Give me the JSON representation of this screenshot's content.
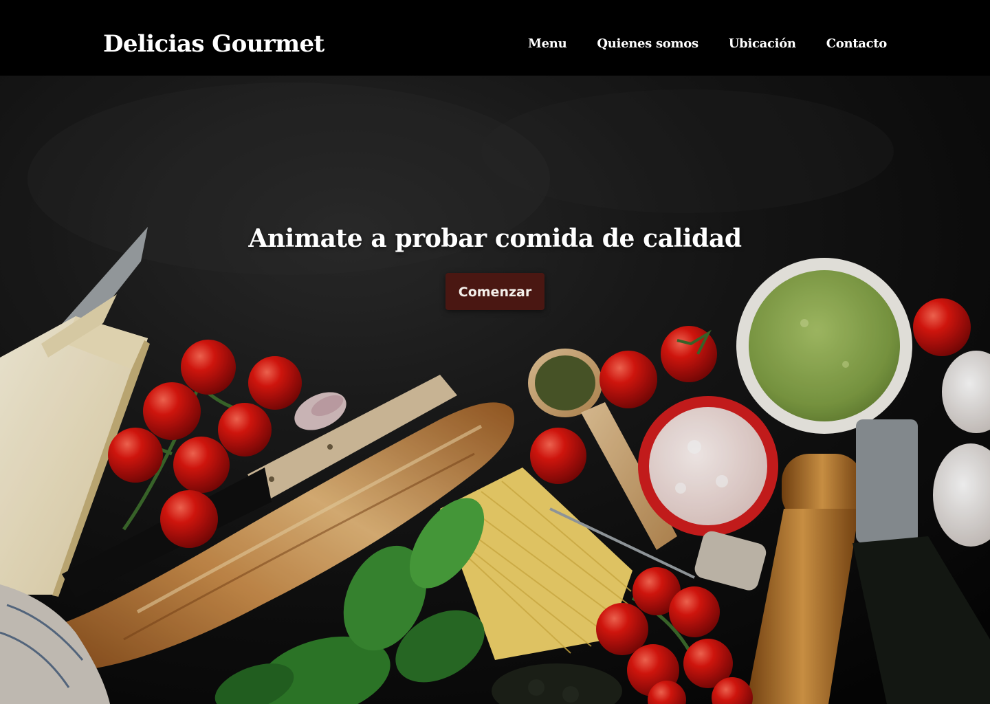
{
  "site": {
    "brand": "Delicias Gourmet"
  },
  "nav": {
    "items": [
      {
        "label": "Menu"
      },
      {
        "label": "Quienes somos"
      },
      {
        "label": "Ubicación"
      },
      {
        "label": "Contacto"
      }
    ]
  },
  "hero": {
    "title": "Animate a probar comida de calidad",
    "cta_label": "Comenzar",
    "image": "hero-food-photo"
  },
  "colors": {
    "page_background": "#000000",
    "text": "#ffffff",
    "button_background": "#4a1712",
    "button_text": "#f4efea"
  }
}
